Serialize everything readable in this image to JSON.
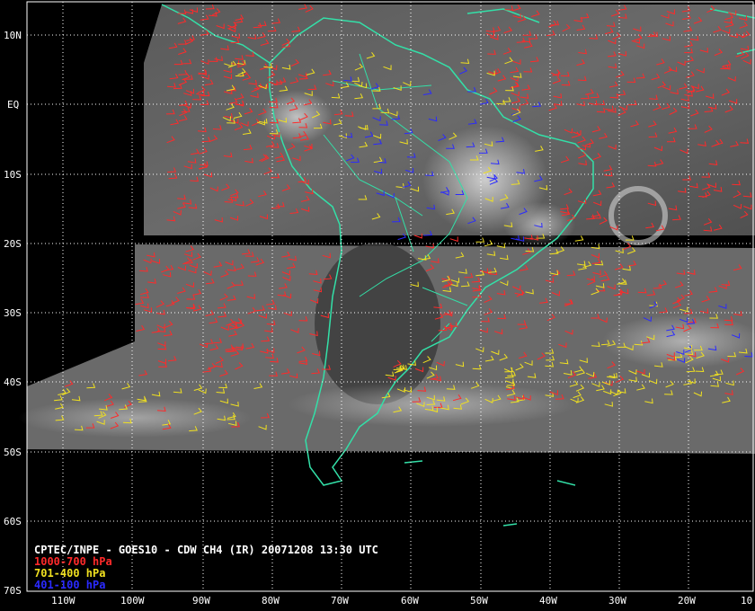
{
  "title": "CPTEC/INPE - GOES10 - CDW CH4 (IR) 20071208 13:30 UTC",
  "legend": [
    {
      "label": "1000-700 hPa",
      "color": "#ff2a2a"
    },
    {
      "label": "701-400 hPa",
      "color": "#f0e020"
    },
    {
      "label": "401-100 hPa",
      "color": "#2a2aff"
    }
  ],
  "colors": {
    "coastline": "#33e0a8",
    "grid": "#ffffff",
    "background": "#000000"
  },
  "latitude_labels": [
    "10N",
    "EQ",
    "10S",
    "20S",
    "30S",
    "40S",
    "50S",
    "60S",
    "70S"
  ],
  "longitude_labels": [
    "110W",
    "100W",
    "90W",
    "80W",
    "70W",
    "60W",
    "50W",
    "40W",
    "30W",
    "20W",
    "10"
  ]
}
